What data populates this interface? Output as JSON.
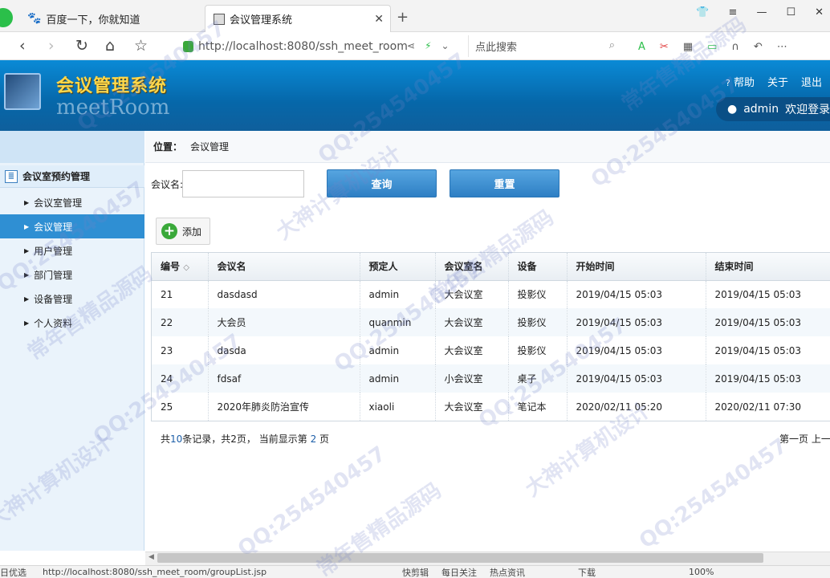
{
  "browser": {
    "tabs": [
      {
        "title": "百度一下，你就知道",
        "icon": "paw-icon"
      },
      {
        "title": "会议管理系统",
        "icon": "page-icon",
        "active": true
      }
    ],
    "address": "http://localhost:8080/ssh_meet_room",
    "search_placeholder": "点此搜索",
    "status_url": "http://localhost:8080/ssh_meet_room/groupList.jsp",
    "status_left": "日优选",
    "status_items": [
      "快剪辑",
      "每日关注",
      "热点资讯",
      "下载"
    ],
    "zoom": "100%"
  },
  "header": {
    "title": "会议管理系统",
    "subtitle": "meetRoom",
    "links": [
      "帮助",
      "关于",
      "退出"
    ],
    "user": "admin",
    "welcome": "欢迎登录"
  },
  "sidebar": {
    "group": "会议室预约管理",
    "items": [
      {
        "label": "会议室管理",
        "active": false
      },
      {
        "label": "会议管理",
        "active": true
      },
      {
        "label": "用户管理",
        "active": false
      },
      {
        "label": "部门管理",
        "active": false
      },
      {
        "label": "设备管理",
        "active": false
      },
      {
        "label": "个人资料",
        "active": false
      }
    ]
  },
  "breadcrumb": {
    "label": "位置：",
    "current": "会议管理"
  },
  "search": {
    "label": "会议名:",
    "value": "",
    "query_button": "查询",
    "reset_button": "重置"
  },
  "toolbar": {
    "add_label": "添加"
  },
  "table": {
    "columns": [
      "编号",
      "会议名",
      "预定人",
      "会议室名",
      "设备",
      "开始时间",
      "结束时间"
    ],
    "rows": [
      [
        "21",
        "dasdasd",
        "admin",
        "大会议室",
        "投影仪",
        "2019/04/15 05:03",
        "2019/04/15 05:03"
      ],
      [
        "22",
        "大会员",
        "quanmin",
        "大会议室",
        "投影仪",
        "2019/04/15 05:03",
        "2019/04/15 05:03"
      ],
      [
        "23",
        "dasda",
        "admin",
        "大会议室",
        "投影仪",
        "2019/04/15 05:03",
        "2019/04/15 05:03"
      ],
      [
        "24",
        "fdsaf",
        "admin",
        "小会议室",
        "桌子",
        "2019/04/15 05:03",
        "2019/04/15 05:03"
      ],
      [
        "25",
        "2020年肺炎防治宣传",
        "xiaoli",
        "大会议室",
        "笔记本",
        "2020/02/11 05:20",
        "2020/02/11 07:30"
      ]
    ]
  },
  "pager": {
    "prefix": "共",
    "total": "10",
    "mid": "条记录，共2页， 当前显示第 ",
    "current": "2",
    "suffix": " 页",
    "first": "第一页",
    "prev": "上一"
  },
  "watermarks": [
    "QQ:254540457",
    "常年售精品源码",
    "大神计算机设计"
  ],
  "colors": {
    "header": "#0a6fb5",
    "active_item": "#2f8fd3",
    "title": "#ffd84a",
    "button": "#3d8fd0"
  }
}
